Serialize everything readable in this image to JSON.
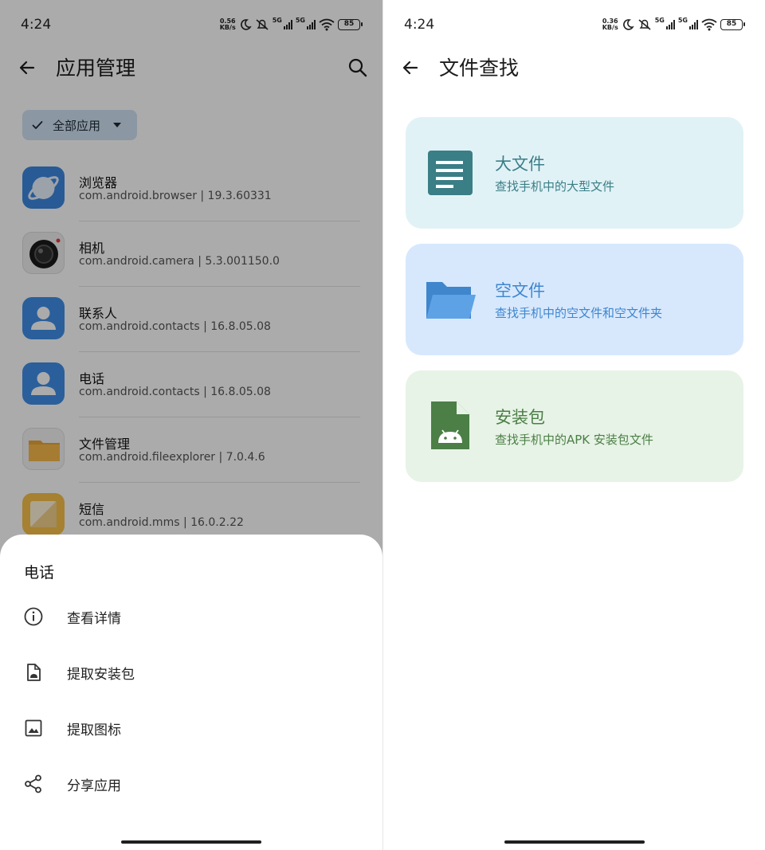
{
  "left": {
    "status": {
      "time": "4:24",
      "speed_value": "0.56",
      "speed_unit": "KB/s",
      "network": "5G",
      "network2": "5G",
      "battery": "85"
    },
    "appbar": {
      "title": "应用管理",
      "back_icon": "arrow-left-icon",
      "search_icon": "search-icon"
    },
    "filter_chip": {
      "label": "全部应用"
    },
    "apps": [
      {
        "name": "浏览器",
        "pkg": "com.android.browser | 19.3.60331",
        "icon": "browser-icon"
      },
      {
        "name": "相机",
        "pkg": "com.android.camera | 5.3.001150.0",
        "icon": "camera-icon"
      },
      {
        "name": "联系人",
        "pkg": "com.android.contacts | 16.8.05.08",
        "icon": "contacts-icon"
      },
      {
        "name": "电话",
        "pkg": "com.android.contacts | 16.8.05.08",
        "icon": "phone-icon"
      },
      {
        "name": "文件管理",
        "pkg": "com.android.fileexplorer | 7.0.4.6",
        "icon": "file-manager-icon"
      },
      {
        "name": "短信",
        "pkg": "com.android.mms | 16.0.2.22",
        "icon": "messages-icon"
      }
    ],
    "sheet": {
      "title": "电话",
      "items": [
        {
          "label": "查看详情",
          "icon": "info-icon"
        },
        {
          "label": "提取安装包",
          "icon": "apk-file-icon"
        },
        {
          "label": "提取图标",
          "icon": "image-icon"
        },
        {
          "label": "分享应用",
          "icon": "share-icon"
        }
      ]
    }
  },
  "right": {
    "status": {
      "time": "4:24",
      "speed_value": "0.36",
      "speed_unit": "KB/s",
      "network": "5G",
      "network2": "5G",
      "battery": "85"
    },
    "appbar": {
      "title": "文件查找",
      "back_icon": "arrow-left-icon"
    },
    "cards": [
      {
        "title": "大文件",
        "subtitle": "查找手机中的大型文件",
        "icon": "document-icon",
        "color": "#3a7e86"
      },
      {
        "title": "空文件",
        "subtitle": "查找手机中的空文件和空文件夹",
        "icon": "folder-icon",
        "color": "#3f86cd"
      },
      {
        "title": "安装包",
        "subtitle": "查找手机中的APK 安装包文件",
        "icon": "android-file-icon",
        "color": "#4b7f46"
      }
    ]
  }
}
